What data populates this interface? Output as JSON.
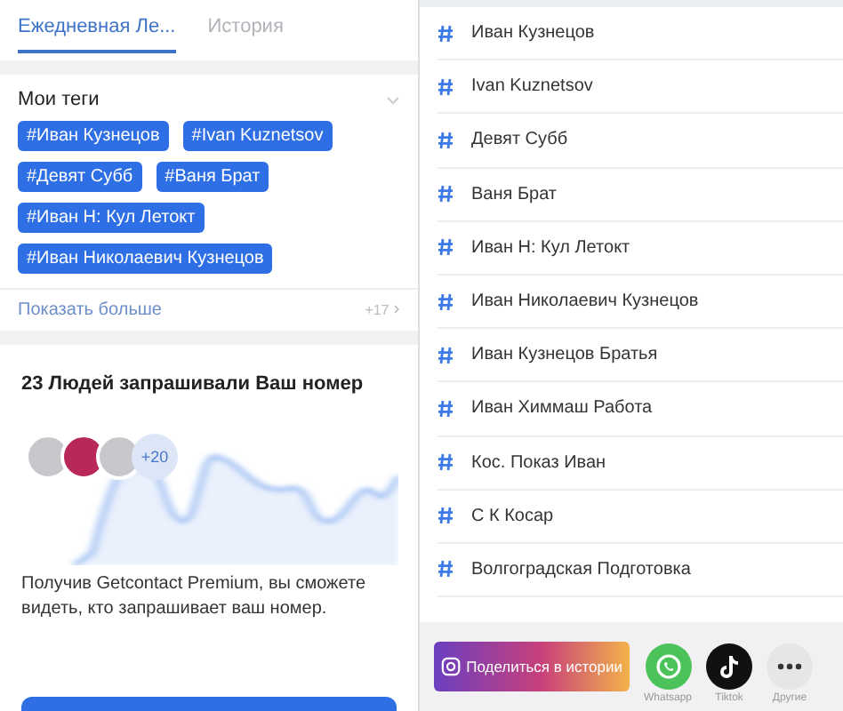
{
  "tabs": [
    {
      "label": "Ежедневная Ле...",
      "selected": true
    },
    {
      "label": "История",
      "selected": false
    }
  ],
  "tags_card": {
    "title": "Мои теги",
    "expanded": false,
    "tags": [
      "#Иван Кузнецов",
      "#Ivan Kuznetsov",
      "#Девят Субб",
      "#Ваня Брат",
      "#Иван Н: Кул Летокт",
      "#Иван Николаевич Кузнецов"
    ],
    "show_more": "Показать больше",
    "more_count": "+17"
  },
  "premium_card": {
    "title": "23 Людей запрашивали Ваш номер",
    "avatars": [
      {
        "color": "#c8c8cc"
      },
      {
        "color": "#b8285a"
      },
      {
        "color": "#c8c8cc"
      }
    ],
    "extra_count": "+20",
    "text": "Получив Getcontact Premium, вы сможете видеть, кто запрашивает ваш номер."
  },
  "tag_list": [
    "Иван Кузнецов",
    "Ivan Kuznetsov",
    "Девят Субб",
    "Ваня Брат",
    "Иван Н: Кул Летокт",
    "Иван Николаевич Кузнецов",
    "Иван Кузнецов Братья",
    "Иван Химмаш Работа",
    "Кос. Показ Иван",
    "С К Косар",
    "Волгоградская Подготовка"
  ],
  "share_bar": {
    "story_button": "Поделиться в истории",
    "apps": [
      {
        "kind": "whatsapp",
        "label": "Whatsapp"
      },
      {
        "kind": "tiktok",
        "label": "Tiktok"
      },
      {
        "kind": "more",
        "label": "Другие"
      }
    ]
  }
}
